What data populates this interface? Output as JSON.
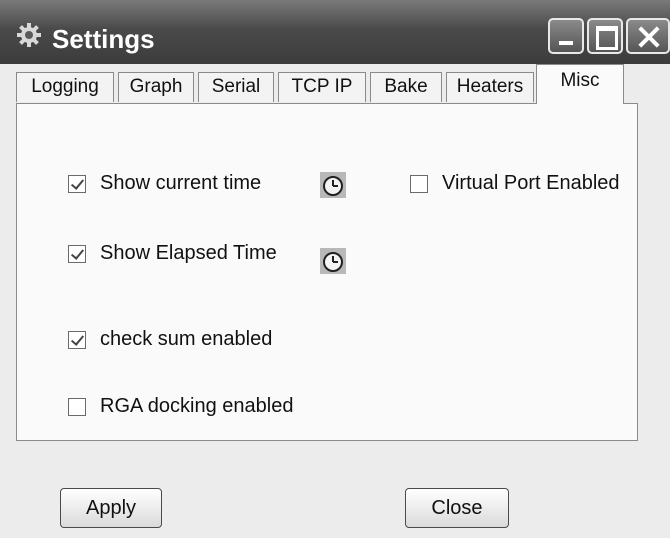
{
  "window": {
    "title": "Settings",
    "icon": "gear-icon"
  },
  "tabs": [
    {
      "label": "Logging",
      "active": false
    },
    {
      "label": "Graph",
      "active": false
    },
    {
      "label": "Serial",
      "active": false
    },
    {
      "label": "TCP IP",
      "active": false
    },
    {
      "label": "Bake",
      "active": false
    },
    {
      "label": "Heaters",
      "active": false
    },
    {
      "label": "Misc",
      "active": true
    }
  ],
  "misc": {
    "show_current_time": {
      "label": "Show current time",
      "checked": true,
      "icon": "clock-icon"
    },
    "show_elapsed_time": {
      "label": "Show Elapsed Time",
      "checked": true,
      "icon": "clock-icon"
    },
    "check_sum": {
      "label": "check sum enabled",
      "checked": true
    },
    "rga_docking": {
      "label": "RGA docking enabled",
      "checked": false
    },
    "virtual_port": {
      "label": "Virtual Port Enabled",
      "checked": false
    }
  },
  "buttons": {
    "apply": "Apply",
    "close": "Close"
  }
}
